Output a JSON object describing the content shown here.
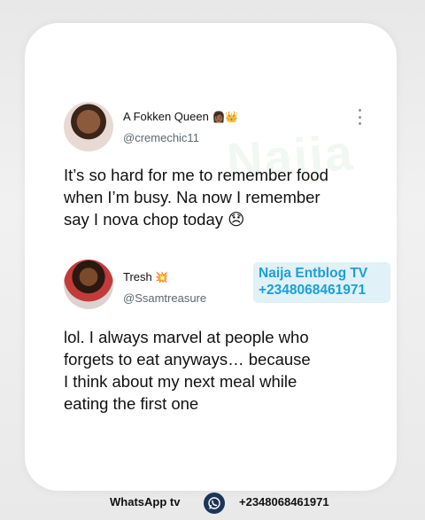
{
  "tweet1": {
    "display_name": "A Fokken Queen",
    "emojis": "👩🏾👑",
    "handle": "@cremechic11",
    "lines": [
      "It’s so hard for me to remember food",
      "when I’m busy. Na now I remember",
      "say I nova chop today 😞"
    ]
  },
  "tweet2": {
    "display_name": "Tresh",
    "emojis": "💥",
    "handle": "@Ssamtreasure",
    "lines": [
      "lol. I always marvel at people who",
      "forgets to eat anyways… because",
      "I think about my next meal while",
      "eating the first one"
    ]
  },
  "watermark_badge": {
    "line1": "Naija Entblog TV",
    "line2": "+2348068461971"
  },
  "footer": {
    "label": "WhatsApp tv",
    "phone": "+2348068461971"
  },
  "colors": {
    "badge_bg": "#e0f1f7",
    "badge_text": "#1aa0d8",
    "handle_text": "#5b6772"
  },
  "icons": [
    "more-options-icon",
    "whatsapp-icon"
  ]
}
